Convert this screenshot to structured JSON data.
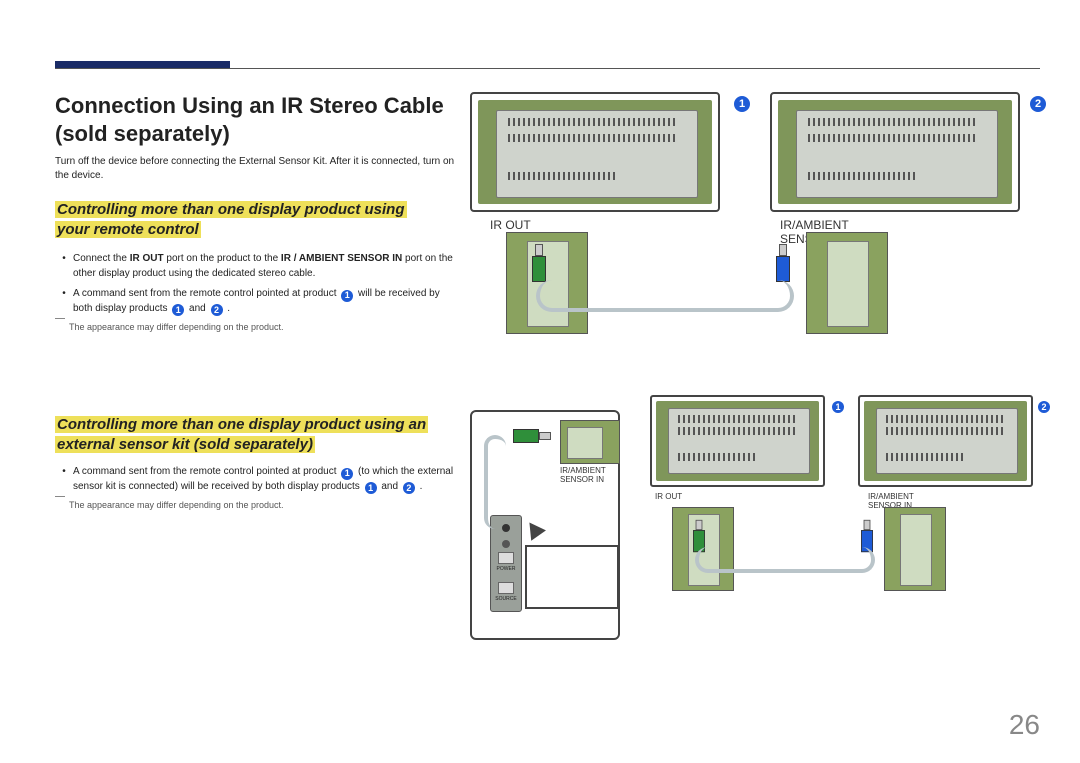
{
  "page_number": "26",
  "title_line1": "Connection Using an IR Stereo Cable",
  "title_line2": "(sold separately)",
  "intro": "Turn off the device before connecting the External Sensor Kit. After it is connected, turn on the device.",
  "sub1_line1": "Controlling more than one display product using",
  "sub1_line2": "your remote control",
  "s1_bullet1a": "Connect the ",
  "s1_bullet1b": "IR OUT",
  "s1_bullet1c": " port on the product to the ",
  "s1_bullet1d": "IR / AMBIENT SENSOR IN",
  "s1_bullet1e": " port on the other display product using the dedicated stereo cable.",
  "s1_bullet2a": "A command sent from the remote control pointed at product ",
  "s1_bullet2b": " will be received by both display products ",
  "s1_bullet2c": " and ",
  "s1_bullet2d": " .",
  "note": "The appearance may differ depending on the product.",
  "sub2_line1": "Controlling more than one display product using an",
  "sub2_line2": "external sensor kit (sold separately)",
  "s2_bullet1a": "A command sent from the remote control pointed at product ",
  "s2_bullet1b": " (to which the external sensor kit is connected) will be received by both display products ",
  "s2_bullet1c": " and ",
  "s2_bullet1d": " .",
  "labels": {
    "ir_out": "IR OUT",
    "ir_in": "IR/AMBIENT\nSENSOR IN",
    "ir_in_small": "IR/AMBIENT\nSENSOR IN",
    "ir_out_small": "IR OUT",
    "power": "POWER",
    "source": "SOURCE"
  },
  "nums": {
    "one": "1",
    "two": "2"
  }
}
